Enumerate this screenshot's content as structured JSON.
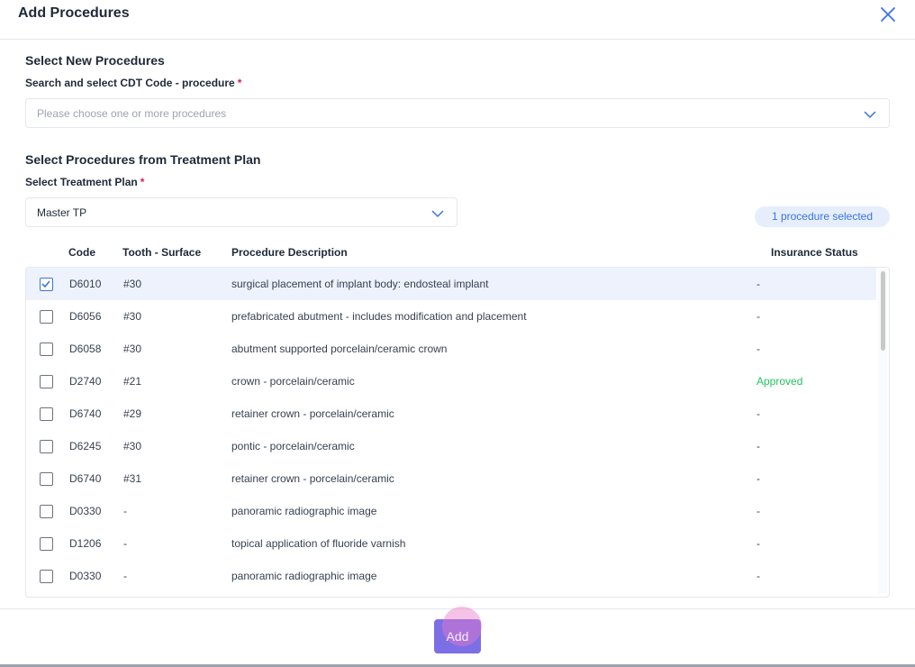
{
  "dialog": {
    "title": "Add Procedures",
    "close_icon": "close-icon"
  },
  "new_procedures": {
    "section_title": "Select New Procedures",
    "field_label": "Search and select CDT Code - procedure",
    "required_mark": "*",
    "placeholder": "Please choose one or more procedures"
  },
  "treatment_plan": {
    "section_title": "Select Procedures from Treatment Plan",
    "field_label": "Select Treatment Plan",
    "required_mark": "*",
    "selected_value": "Master TP",
    "selection_badge": "1 procedure selected"
  },
  "table": {
    "columns": [
      "Code",
      "Tooth - Surface",
      "Procedure Description",
      "Insurance Status"
    ],
    "rows": [
      {
        "checked": true,
        "code": "D6010",
        "tooth": "#30",
        "description": "surgical placement of implant body: endosteal implant",
        "status": "-"
      },
      {
        "checked": false,
        "code": "D6056",
        "tooth": "#30",
        "description": "prefabricated abutment - includes modification and placement",
        "status": "-"
      },
      {
        "checked": false,
        "code": "D6058",
        "tooth": "#30",
        "description": "abutment supported porcelain/ceramic crown",
        "status": "-"
      },
      {
        "checked": false,
        "code": "D2740",
        "tooth": "#21",
        "description": "crown - porcelain/ceramic",
        "status": "Approved"
      },
      {
        "checked": false,
        "code": "D6740",
        "tooth": "#29",
        "description": "retainer crown - porcelain/ceramic",
        "status": "-"
      },
      {
        "checked": false,
        "code": "D6245",
        "tooth": "#30",
        "description": "pontic - porcelain/ceramic",
        "status": "-"
      },
      {
        "checked": false,
        "code": "D6740",
        "tooth": "#31",
        "description": "retainer crown - porcelain/ceramic",
        "status": "-"
      },
      {
        "checked": false,
        "code": "D0330",
        "tooth": "-",
        "description": "panoramic radiographic image",
        "status": "-"
      },
      {
        "checked": false,
        "code": "D1206",
        "tooth": "-",
        "description": "topical application of fluoride varnish",
        "status": "-"
      },
      {
        "checked": false,
        "code": "D0330",
        "tooth": "-",
        "description": "panoramic radiographic image",
        "status": "-"
      }
    ]
  },
  "footer": {
    "add_label": "Add"
  },
  "colors": {
    "accent": "#3b73e3",
    "approved": "#22c55e",
    "add_button": "#7c6fe6",
    "selected_row": "#eef2fd"
  }
}
